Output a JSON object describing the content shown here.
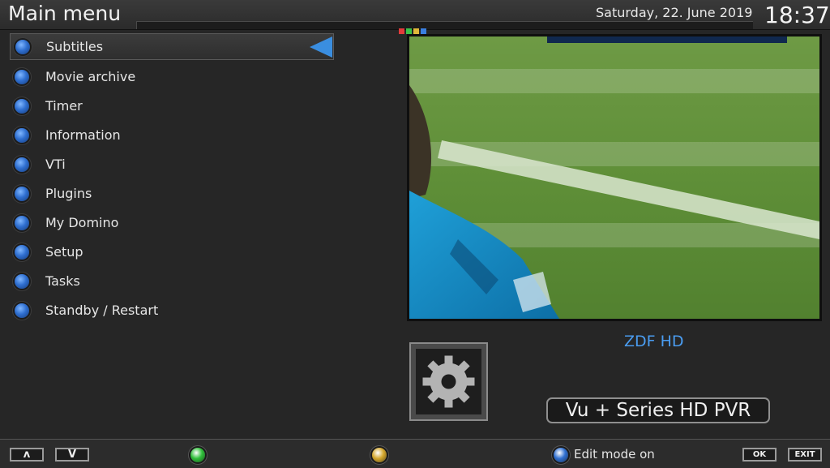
{
  "header": {
    "title": "Main menu",
    "date": "Saturday, 22. June 2019",
    "time": "18:37",
    "indicator_colors": [
      "#e33b3b",
      "#3cc24a",
      "#e0b83a",
      "#3a7fe0"
    ]
  },
  "menu": {
    "selected_index": 0,
    "items": [
      {
        "label": "Subtitles"
      },
      {
        "label": "Movie archive"
      },
      {
        "label": "Timer"
      },
      {
        "label": "Information"
      },
      {
        "label": "VTi"
      },
      {
        "label": "Plugins"
      },
      {
        "label": "My Domino"
      },
      {
        "label": "Setup"
      },
      {
        "label": "Tasks"
      },
      {
        "label": "Standby / Restart"
      }
    ]
  },
  "preview": {
    "channel": "ZDF HD"
  },
  "icons": {
    "settings": "gear-icon",
    "selection": "arrow-left-icon"
  },
  "model": {
    "label": "Vu + Series HD PVR"
  },
  "footer": {
    "up_label": "ʌ",
    "down_label": "V",
    "green_color": "#2fbf3a",
    "yellow_color": "#d4a72c",
    "blue_color": "#2f6fd0",
    "blue_label": "Edit mode on",
    "ok_label": "OK",
    "exit_label": "EXIT"
  },
  "colors": {
    "accent_blue": "#3a8ee0",
    "channel_text": "#4a9cf0"
  }
}
